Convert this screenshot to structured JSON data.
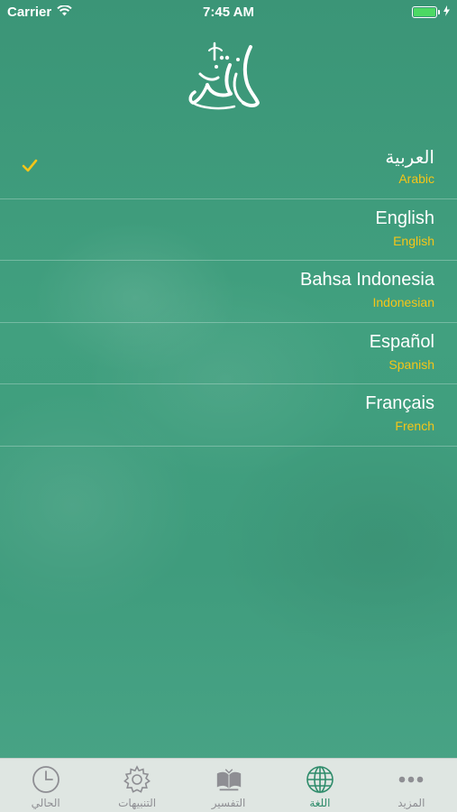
{
  "status_bar": {
    "carrier": "Carrier",
    "time": "7:45 AM",
    "battery_level": 1.0
  },
  "app": {
    "logo_text": "نختم"
  },
  "languages": [
    {
      "name": "العربية",
      "sub": "Arabic",
      "selected": true
    },
    {
      "name": "English",
      "sub": "English",
      "selected": false
    },
    {
      "name": "Bahsa Indonesia",
      "sub": "Indonesian",
      "selected": false
    },
    {
      "name": "Español",
      "sub": "Spanish",
      "selected": false
    },
    {
      "name": "Français",
      "sub": "French",
      "selected": false
    }
  ],
  "tab_bar": {
    "tabs": [
      {
        "label": "الحالي",
        "icon": "clock-icon",
        "active": false
      },
      {
        "label": "التنبيهات",
        "icon": "gear-icon",
        "active": false
      },
      {
        "label": "التفسير",
        "icon": "quran-book-icon",
        "active": false
      },
      {
        "label": "اللغة",
        "icon": "globe-icon",
        "active": true
      },
      {
        "label": "المزيد",
        "icon": "more-dots-icon",
        "active": false
      }
    ]
  },
  "colors": {
    "accent": "#2f8c6b",
    "highlight": "#f5c518",
    "background": "#3f9a7c",
    "tab_inactive": "#8e8e93"
  }
}
